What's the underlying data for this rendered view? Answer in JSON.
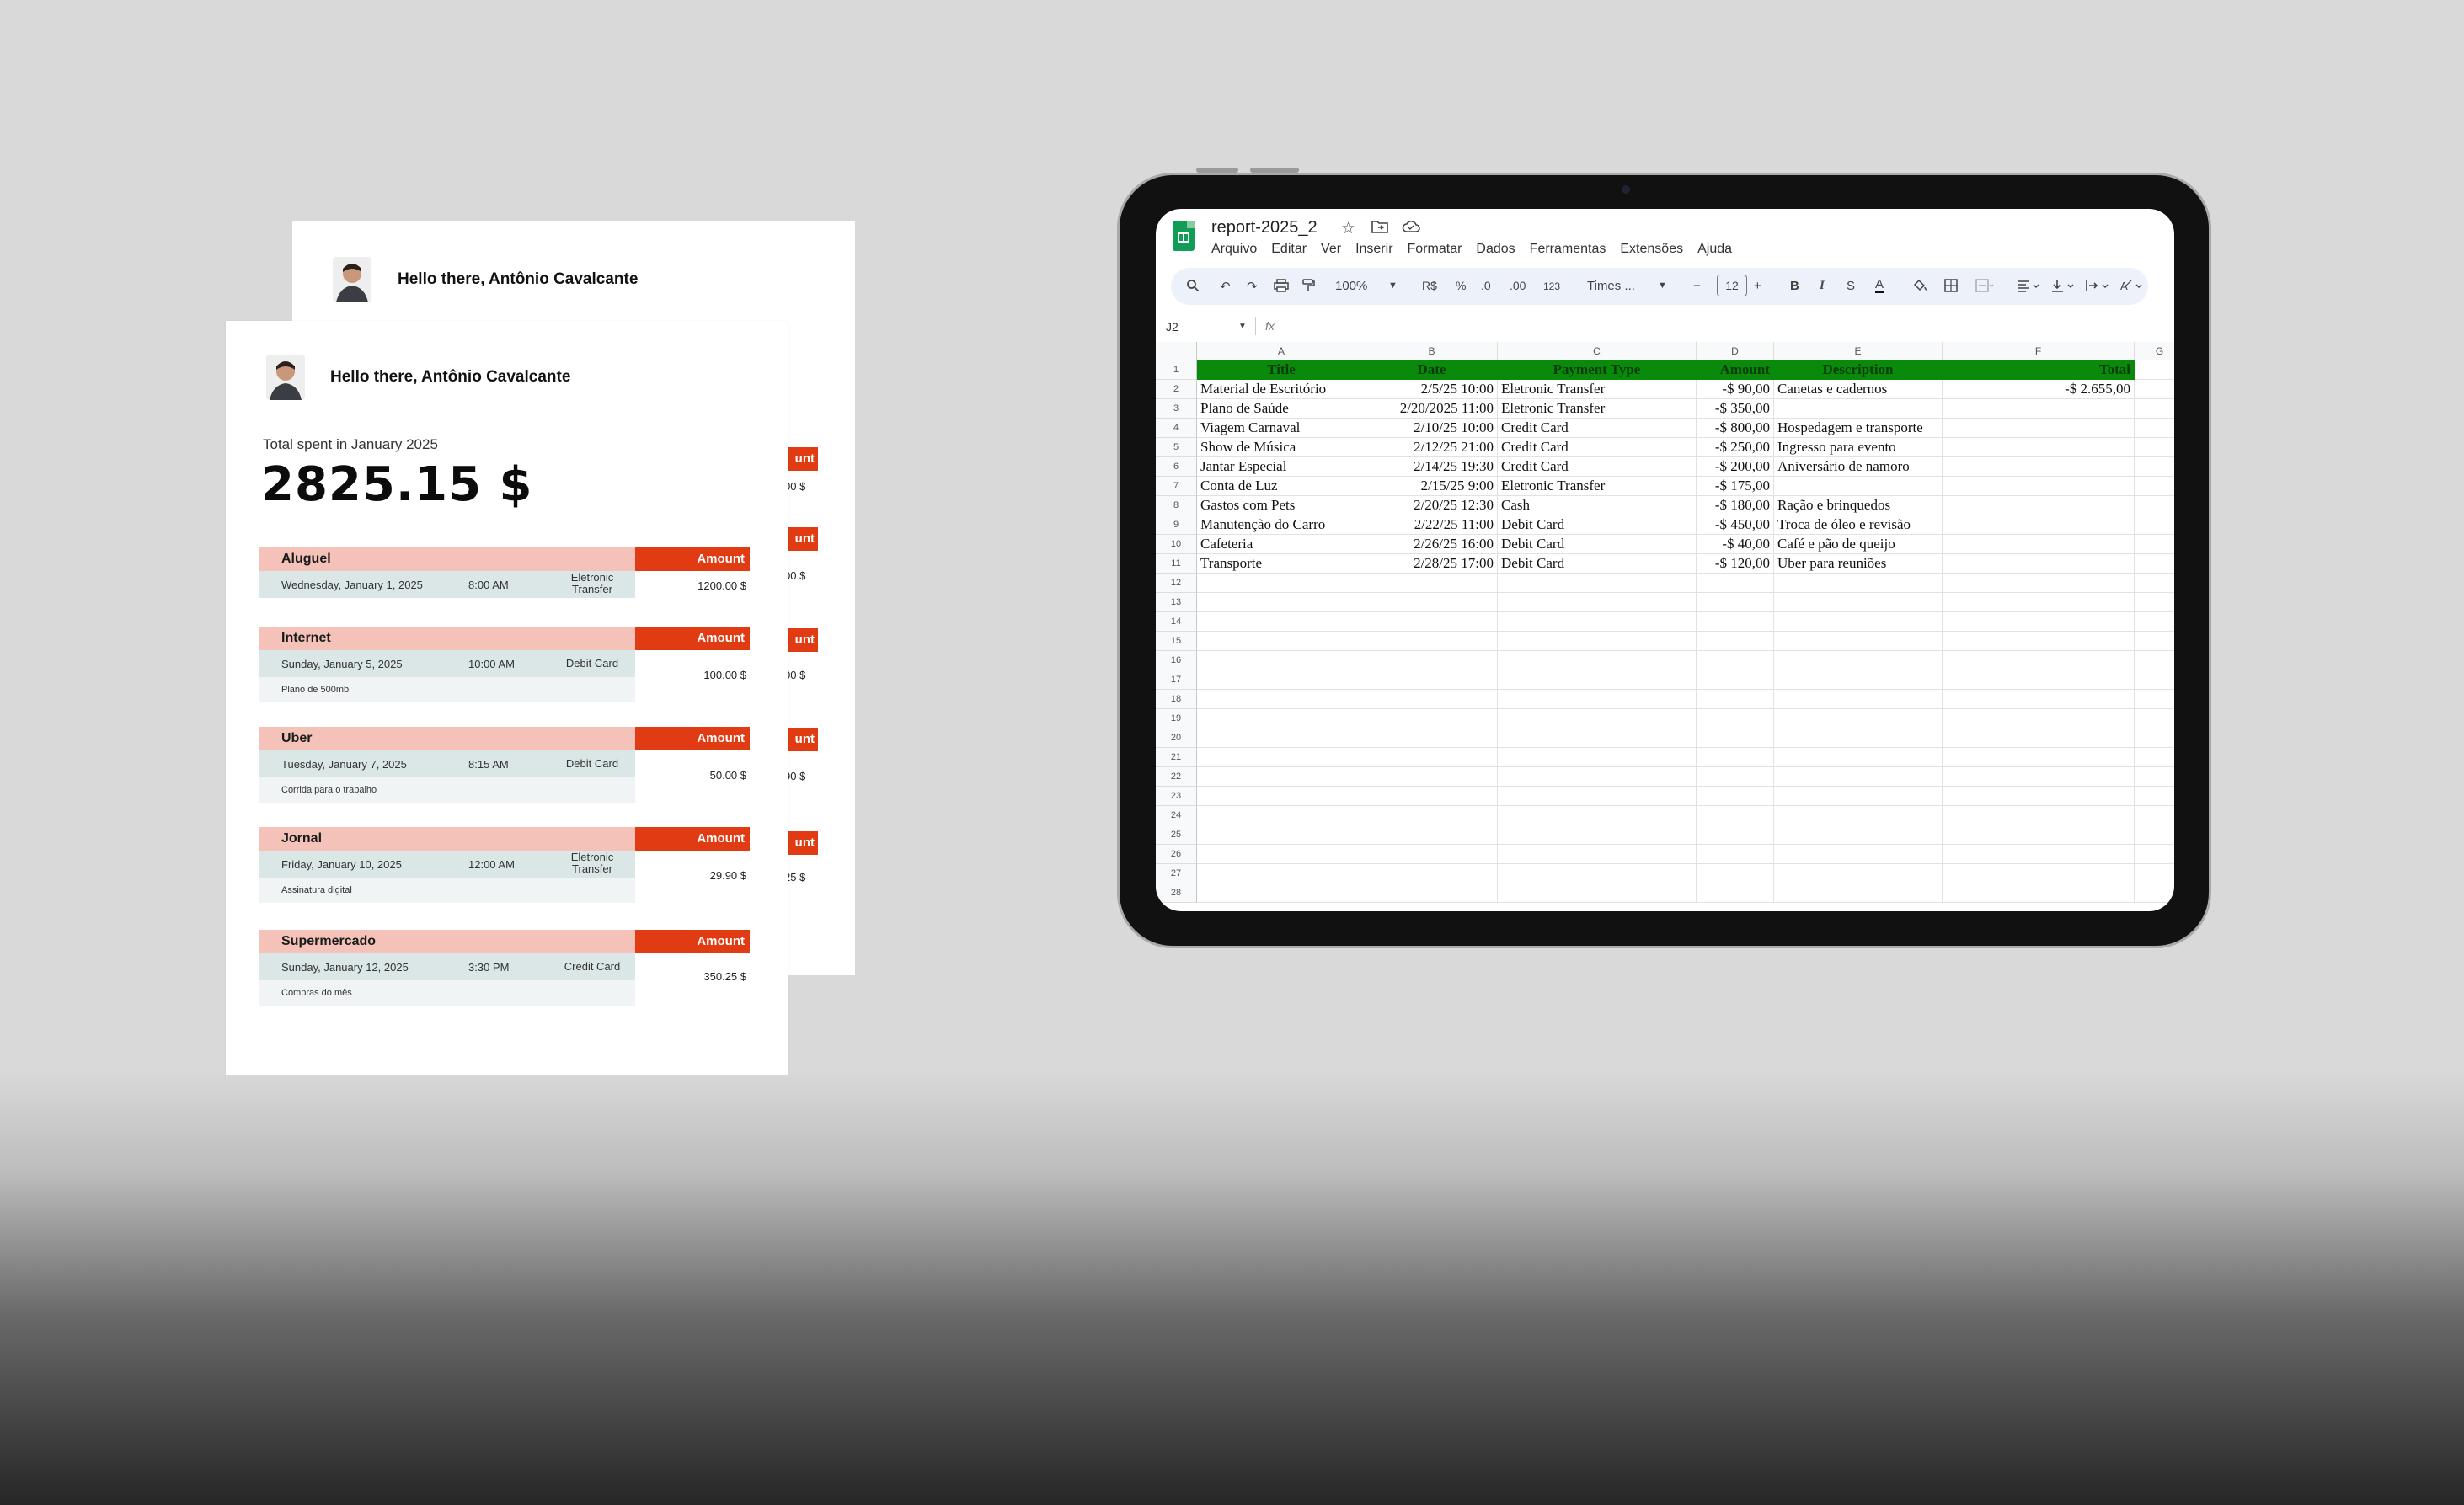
{
  "report": {
    "greeting": "Hello there, Antônio Cavalcante",
    "total_label": "Total spent in January 2025",
    "total_value": "2825.15 $",
    "amount_header": "Amount",
    "amount_header_partial": "unt",
    "back_values": [
      "00 $",
      "00 $",
      "00 $",
      "90 $",
      "25 $"
    ],
    "entries": [
      {
        "title": "Aluguel",
        "date": "Wednesday, January 1, 2025",
        "time": "8:00 AM",
        "payment": "Eletronic Transfer",
        "note": "",
        "amount": "1200.00 $"
      },
      {
        "title": "Internet",
        "date": "Sunday, January 5, 2025",
        "time": "10:00 AM",
        "payment": "Debit Card",
        "note": "Plano de 500mb",
        "amount": "100.00 $"
      },
      {
        "title": "Uber",
        "date": "Tuesday, January 7, 2025",
        "time": "8:15 AM",
        "payment": "Debit Card",
        "note": "Corrida para o trabalho",
        "amount": "50.00 $"
      },
      {
        "title": "Jornal",
        "date": "Friday, January 10, 2025",
        "time": "12:00 AM",
        "payment": "Eletronic Transfer",
        "note": "Assinatura digital",
        "amount": "29.90 $"
      },
      {
        "title": "Supermercado",
        "date": "Sunday, January 12, 2025",
        "time": "3:30 PM",
        "payment": "Credit Card",
        "note": "Compras do mês",
        "amount": "350.25 $"
      }
    ]
  },
  "spreadsheet": {
    "doc_title": "report-2025_2",
    "menu": [
      "Arquivo",
      "Editar",
      "Ver",
      "Inserir",
      "Formatar",
      "Dados",
      "Ferramentas",
      "Extensões",
      "Ajuda"
    ],
    "toolbar": {
      "zoom": "100%",
      "currency": "R$",
      "percent": "%",
      "dec_dec": ".0",
      "dec_inc": ".00",
      "number_fmt": "123",
      "font": "Times ...",
      "font_size": "12"
    },
    "name_box": "J2",
    "fx": "fx",
    "columns": [
      "A",
      "B",
      "C",
      "D",
      "E",
      "F",
      "G"
    ],
    "header_row": [
      "Title",
      "Date",
      "Payment Type",
      "Amount",
      "Description",
      "Total"
    ],
    "rows": [
      [
        "Material de Escritório",
        "2/5/25 10:00",
        "Eletronic Transfer",
        "-$ 90,00",
        "Canetas e cadernos",
        "-$ 2.655,00"
      ],
      [
        "Plano de Saúde",
        "2/20/2025  11:00",
        "Eletronic Transfer",
        "-$ 350,00",
        "",
        ""
      ],
      [
        "Viagem Carnaval",
        "2/10/25 10:00",
        "Credit Card",
        "-$ 800,00",
        "Hospedagem e transporte",
        ""
      ],
      [
        "Show de Música",
        "2/12/25 21:00",
        "Credit Card",
        "-$ 250,00",
        "Ingresso para evento",
        ""
      ],
      [
        "Jantar Especial",
        "2/14/25 19:30",
        "Credit Card",
        "-$ 200,00",
        "Aniversário de namoro",
        ""
      ],
      [
        "Conta de Luz",
        "2/15/25 9:00",
        "Eletronic Transfer",
        "-$ 175,00",
        "",
        ""
      ],
      [
        "Gastos com Pets",
        "2/20/25 12:30",
        "Cash",
        "-$ 180,00",
        "Ração e brinquedos",
        ""
      ],
      [
        "Manutenção do Carro",
        "2/22/25 11:00",
        "Debit Card",
        "-$ 450,00",
        "Troca de óleo e revisão",
        ""
      ],
      [
        "Cafeteria",
        "2/26/25 16:00",
        "Debit Card",
        "-$ 40,00",
        "Café e pão de queijo",
        ""
      ],
      [
        "Transporte",
        "2/28/25 17:00",
        "Debit Card",
        "-$ 120,00",
        "Uber para reuniões",
        ""
      ]
    ],
    "row_numbers": [
      "1",
      "2",
      "3",
      "4",
      "5",
      "6",
      "7",
      "8",
      "9",
      "10",
      "11",
      "12",
      "13",
      "14",
      "15",
      "16",
      "17",
      "18",
      "19",
      "20",
      "21",
      "22",
      "23",
      "24",
      "25",
      "26",
      "27",
      "28"
    ]
  }
}
